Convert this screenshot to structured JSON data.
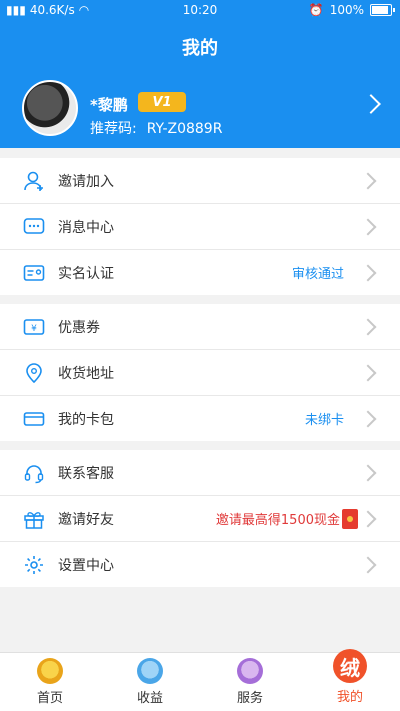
{
  "status_bar": {
    "network": "40.6K/s",
    "time": "10:20",
    "battery": "100%",
    "battery_level": 1.0
  },
  "header": {
    "title": "我的",
    "user_name": "*黎鹏",
    "vip_level": "V1",
    "referral_label": "推荐码:",
    "referral_code": "RY-Z0889R"
  },
  "groups": [
    {
      "items": [
        {
          "label": "邀请加入",
          "value": "",
          "icon": "user-plus-icon"
        },
        {
          "label": "消息中心",
          "value": "",
          "icon": "message-icon"
        },
        {
          "label": "实名认证",
          "value": "审核通过",
          "icon": "id-card-icon"
        }
      ]
    },
    {
      "items": [
        {
          "label": "优惠券",
          "value": "",
          "icon": "coupon-icon"
        },
        {
          "label": "收货地址",
          "value": "",
          "icon": "location-icon"
        },
        {
          "label": "我的卡包",
          "value": "未绑卡",
          "icon": "card-icon"
        }
      ]
    },
    {
      "items": [
        {
          "label": "联系客服",
          "value": "",
          "icon": "headset-icon"
        },
        {
          "label": "邀请好友",
          "value": "邀请最高得1500现金",
          "icon": "gift-icon"
        },
        {
          "label": "设置中心",
          "value": "",
          "icon": "settings-icon"
        }
      ]
    }
  ],
  "tabbar": {
    "items": [
      {
        "label": "首页",
        "icon": "gold-ingot-icon"
      },
      {
        "label": "收益",
        "icon": "income-icon"
      },
      {
        "label": "服务",
        "icon": "piggy-icon"
      },
      {
        "label": "我的",
        "icon": "mine-icon"
      }
    ]
  },
  "colors": {
    "brand_blue": "#1a8ff0",
    "vip_gold": "#f4b61d",
    "accent_red": "#e03a3a"
  }
}
